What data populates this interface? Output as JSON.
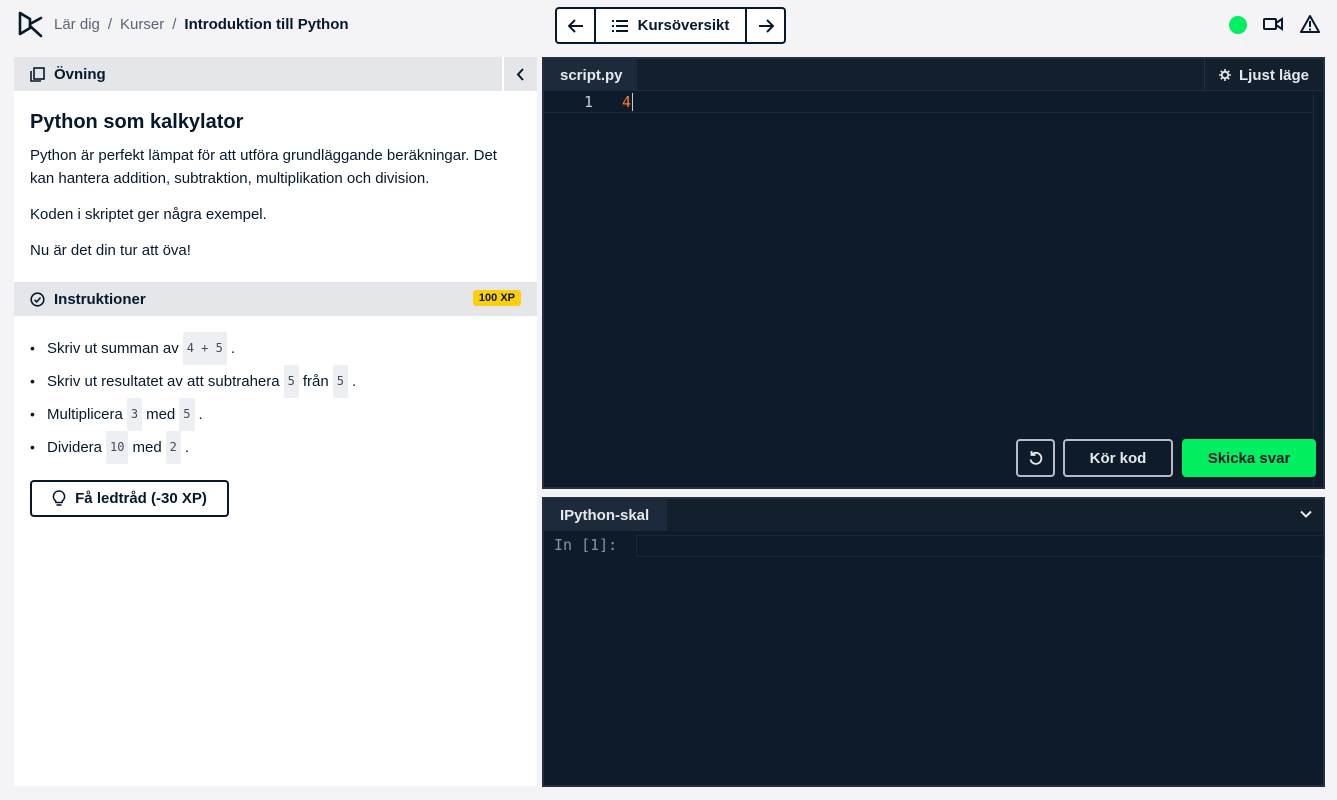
{
  "header": {
    "breadcrumb": [
      "Lär dig",
      "Kurser",
      "Introduktion till Python"
    ],
    "separator": "/",
    "nav": {
      "prev_icon": "arrow-left-icon",
      "overview_label": "Kursöversikt",
      "next_icon": "arrow-right-icon"
    },
    "status_color": "#03ef62"
  },
  "exercise": {
    "section_label": "Övning",
    "title": "Python som kalkylator",
    "paragraphs": [
      "Python är perfekt lämpat för att utföra grundläggande beräkningar. Det kan hantera addition, subtraktion, multiplikation och division.",
      "Koden i skriptet ger några exempel.",
      "Nu är det din tur att öva!"
    ]
  },
  "instructions": {
    "label": "Instruktioner",
    "xp": "100 XP",
    "items": [
      {
        "t1": "Skriv ut summan av",
        "c1": "4 + 5",
        "t2": ".",
        "c2": "",
        "t3": ""
      },
      {
        "t1": "Skriv ut resultatet av att subtrahera",
        "c1": "5",
        "t2": "från",
        "c2": "5",
        "t3": "."
      },
      {
        "t1": "Multiplicera",
        "c1": "3",
        "t2": "med",
        "c2": "5",
        "t3": "."
      },
      {
        "t1": "Dividera",
        "c1": "10",
        "t2": "med",
        "c2": "2",
        "t3": "."
      }
    ],
    "hint_label": "Få ledtråd (-30 XP)"
  },
  "editor": {
    "filename": "script.py",
    "theme_label": "Ljust läge",
    "line_number": "1",
    "line_text": "4",
    "run_label": "Kör kod",
    "submit_label": "Skicka svar",
    "accent": "#03ef62"
  },
  "console": {
    "tab_label": "IPython-skal",
    "prompt": "In [1]:"
  }
}
